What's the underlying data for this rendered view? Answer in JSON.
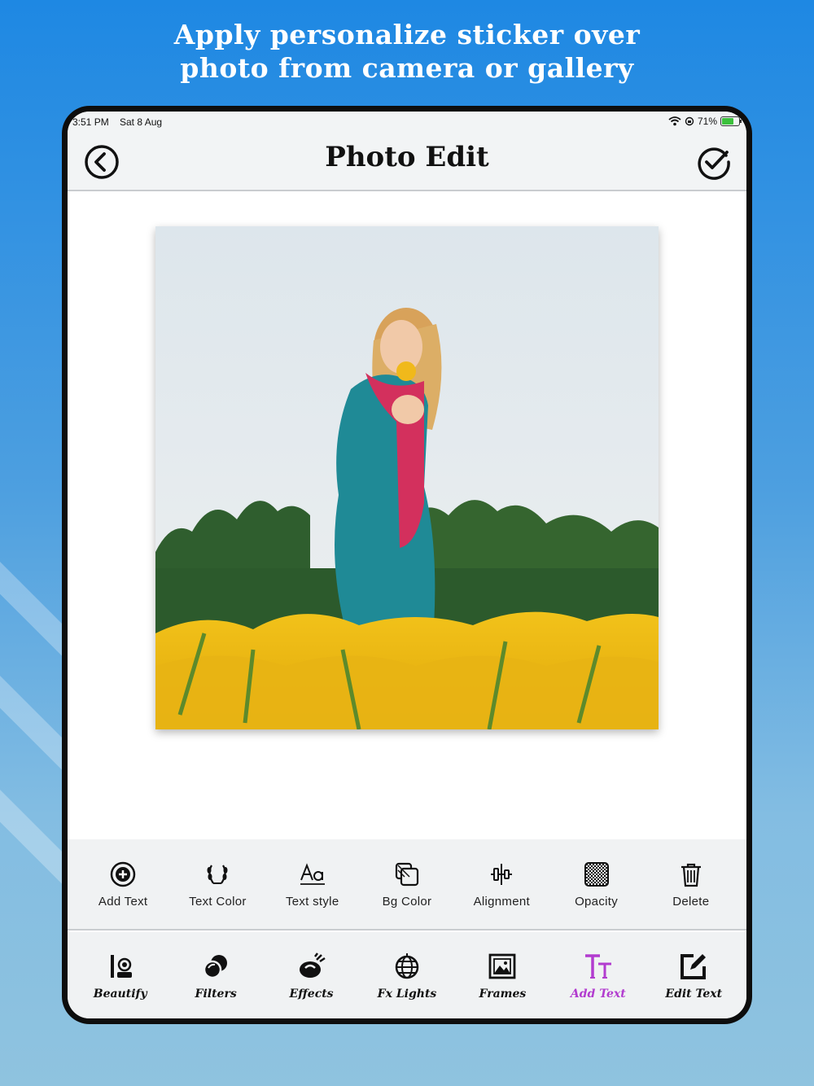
{
  "promo": {
    "line1": "Apply personalize sticker over",
    "line2": "photo from camera or gallery"
  },
  "status_bar": {
    "time": "3:51 PM",
    "date": "Sat 8 Aug",
    "battery": "71%",
    "battery_level": 0.71
  },
  "header": {
    "title": "Photo Edit",
    "back_icon": "back-arrow-circle-icon",
    "done_icon": "check-circle-icon"
  },
  "text_tools": [
    {
      "label": "Add Text",
      "icon": "add-circle-icon"
    },
    {
      "label": "Text Color",
      "icon": "laurel-icon"
    },
    {
      "label": "Text style",
      "icon": "font-aa-icon"
    },
    {
      "label": "Bg Color",
      "icon": "layers-icon"
    },
    {
      "label": "Alignment",
      "icon": "align-center-icon"
    },
    {
      "label": "Opacity",
      "icon": "checker-icon"
    },
    {
      "label": "Delete",
      "icon": "trash-icon"
    }
  ],
  "main_tools": [
    {
      "label": "Beautify",
      "icon": "makeup-icon",
      "active": false
    },
    {
      "label": "Filters",
      "icon": "filters-icon",
      "active": false
    },
    {
      "label": "Effects",
      "icon": "effects-icon",
      "active": false
    },
    {
      "label": "Fx Lights",
      "icon": "disco-ball-icon",
      "active": false
    },
    {
      "label": "Frames",
      "icon": "frame-icon",
      "active": false
    },
    {
      "label": "Add Text",
      "icon": "text-size-icon",
      "active": true
    },
    {
      "label": "Edit Text",
      "icon": "edit-icon",
      "active": false
    }
  ],
  "colors": {
    "active_tool": "#b23ccf",
    "toolbar_bg": "#f0f2f3",
    "page_bg_top": "#1e88e3"
  }
}
